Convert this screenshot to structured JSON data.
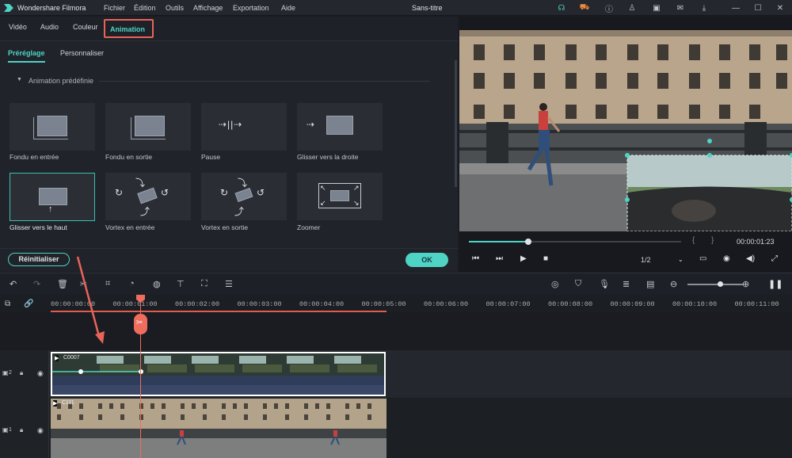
{
  "app": {
    "name": "Wondershare Filmora",
    "document_title": "Sans-titre"
  },
  "menu": [
    "Fichier",
    "Édition",
    "Outils",
    "Affichage",
    "Exportation",
    "Aide"
  ],
  "editor_tabs": [
    "Vidéo",
    "Audio",
    "Couleur",
    "Animation"
  ],
  "active_editor_tab": "Animation",
  "sub_tabs": [
    "Préréglage",
    "Personnaliser"
  ],
  "section_title": "Animation prédéfinie",
  "presets": [
    "Fondu en entrée",
    "Fondu en sortie",
    "Pause",
    "Glisser vers la droite",
    "Glisser vers le haut",
    "Vortex en entrée",
    "Vortex en sortie",
    "Zoomer"
  ],
  "selected_preset": "Glisser vers le haut",
  "buttons": {
    "reset": "Réinitialiser",
    "ok": "OK"
  },
  "preview": {
    "timecode": "00:00:01:23",
    "ratio": "1/2",
    "progress": 0.28,
    "brace_open": "{",
    "brace_close": "}"
  },
  "ruler_ticks": [
    "00:00:00:00",
    "00:00:01:00",
    "00:00:02:00",
    "00:00:03:00",
    "00:00:04:00",
    "00:00:05:00",
    "00:00:06:00",
    "00:00:07:00",
    "00:00:08:00",
    "00:00:09:00",
    "00:00:10:00",
    "00:00:11:00"
  ],
  "clips": {
    "track2_label": "C0007",
    "track1_label": "C111"
  },
  "track_labels": {
    "track2": "2",
    "track1": "1"
  },
  "colors": {
    "accent": "#4fd3c4",
    "highlight": "#e8645a",
    "playhead": "#f06d5e"
  }
}
